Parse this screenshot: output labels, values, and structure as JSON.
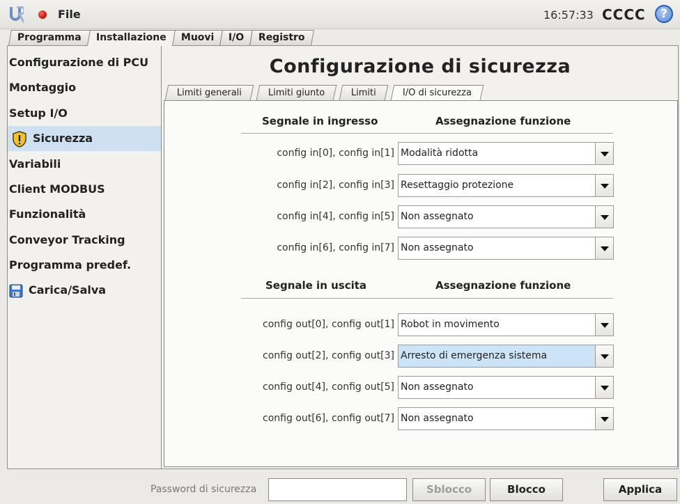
{
  "topbar": {
    "file_label": "File",
    "clock": "16:57:33",
    "robot_name": "CCCC",
    "help_label": "?"
  },
  "main_tabs": [
    "Programma",
    "Installazione",
    "Muovi",
    "I/O",
    "Registro"
  ],
  "sidebar": {
    "items": [
      {
        "label": "Configurazione di PCU"
      },
      {
        "label": "Montaggio"
      },
      {
        "label": "Setup I/O"
      },
      {
        "label": "Sicurezza"
      },
      {
        "label": "Variabili"
      },
      {
        "label": "Client MODBUS"
      },
      {
        "label": "Funzionalità"
      },
      {
        "label": "Conveyor Tracking"
      },
      {
        "label": "Programma predef."
      },
      {
        "label": "Carica/Salva"
      }
    ]
  },
  "panel": {
    "title": "Configurazione di sicurezza",
    "subtabs": [
      "Limiti generali",
      "Limiti giunto",
      "Limiti",
      "I/O di sicurezza"
    ],
    "inputs": {
      "header_signal": "Segnale in ingresso",
      "header_function": "Assegnazione funzione",
      "rows": [
        {
          "label": "config in[0], config in[1]",
          "value": "Modalità ridotta"
        },
        {
          "label": "config in[2], config in[3]",
          "value": "Resettaggio protezione"
        },
        {
          "label": "config in[4], config in[5]",
          "value": "Non assegnato"
        },
        {
          "label": "config in[6], config in[7]",
          "value": "Non assegnato"
        }
      ]
    },
    "outputs": {
      "header_signal": "Segnale in uscita",
      "header_function": "Assegnazione funzione",
      "rows": [
        {
          "label": "config out[0], config out[1]",
          "value": "Robot in movimento"
        },
        {
          "label": "config out[2], config out[3]",
          "value": "Arresto di emergenza sistema"
        },
        {
          "label": "config out[4], config out[5]",
          "value": "Non assegnato"
        },
        {
          "label": "config out[6], config out[7]",
          "value": "Non assegnato"
        }
      ]
    }
  },
  "bottom": {
    "password_label": "Password di sicurezza",
    "password_value": "",
    "unlock_label": "Sblocco",
    "lock_label": "Blocco",
    "apply_label": "Applica"
  },
  "colors": {
    "selected_bg": "#cfe0f3",
    "highlight_dropdown": "#cde4f7",
    "status_dot": "#d0170d",
    "help_blue": "#5b8fd8"
  },
  "icons": {
    "logo": "ur-logo",
    "status": "status-dot-icon",
    "help": "help-icon",
    "safety": "warning-shield-icon",
    "save": "floppy-disk-icon",
    "dropdown": "chevron-down-icon"
  }
}
